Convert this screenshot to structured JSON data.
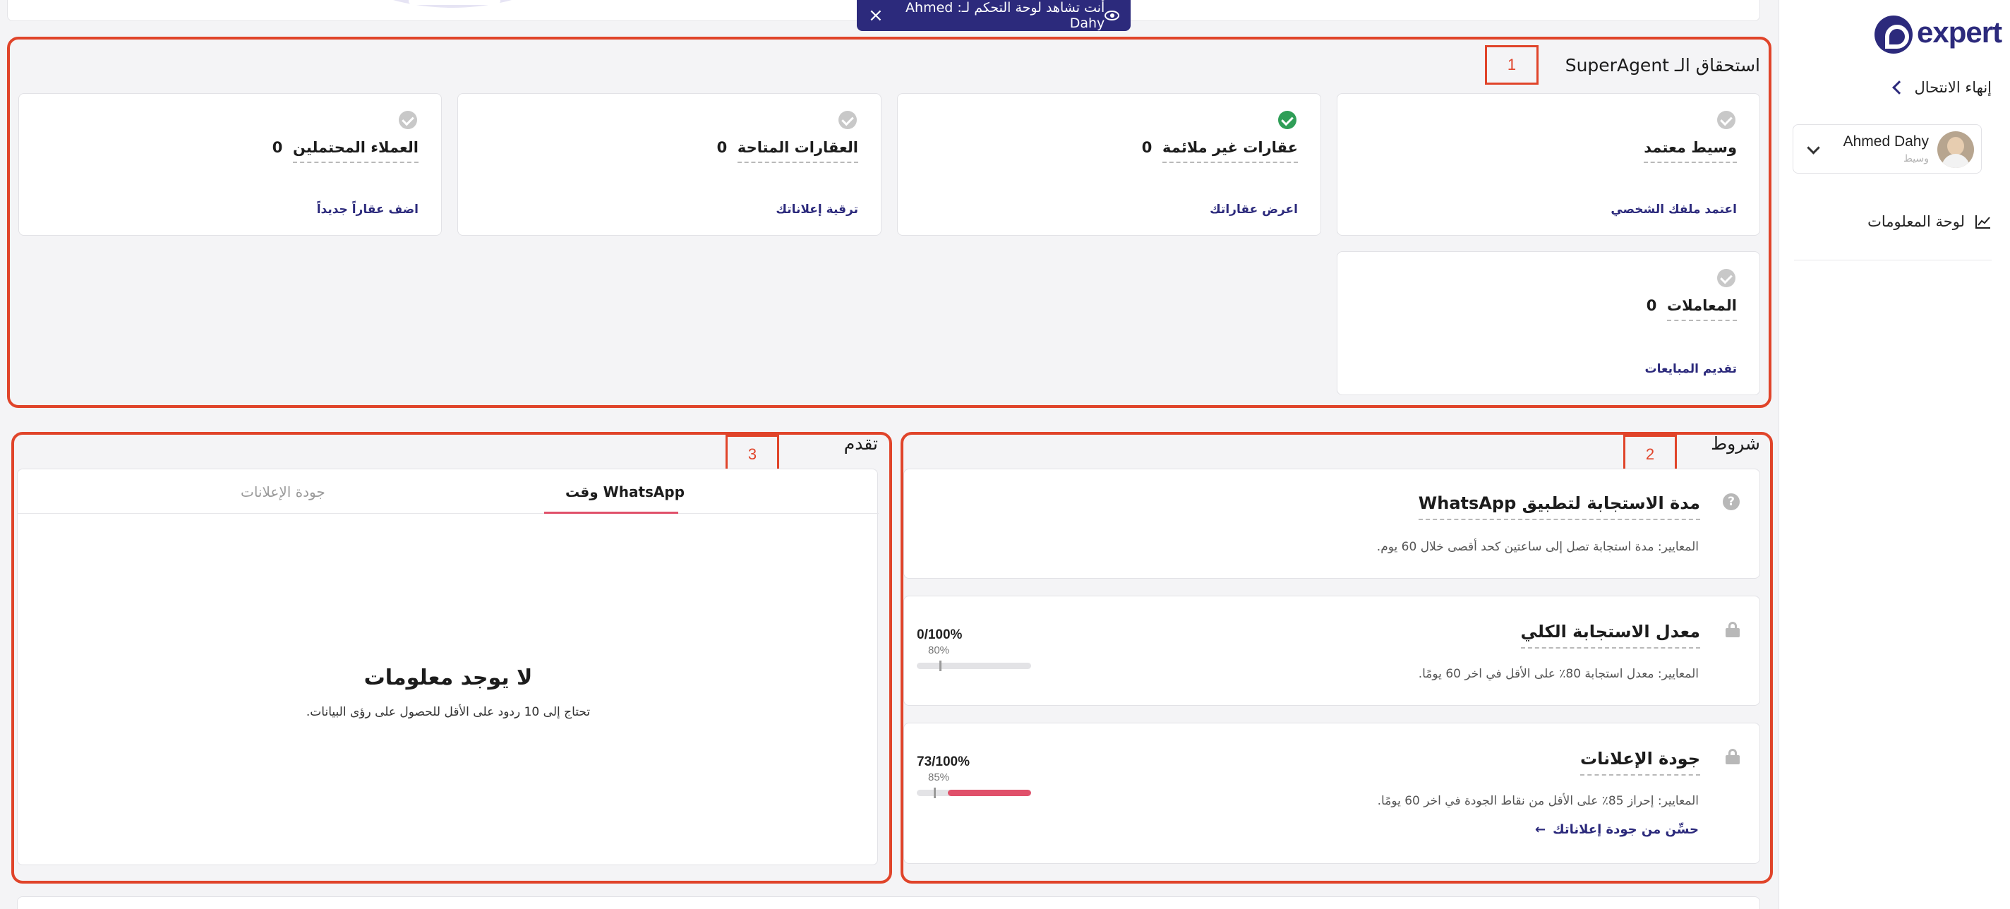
{
  "view_banner": {
    "text": "أنت تشاهد لوحة التحكم لـ: Ahmed Dahy",
    "eye_icon": "eye-icon",
    "close_icon": "close-icon"
  },
  "sidebar": {
    "logo": "expert",
    "end_session": "إنهاء الانتحال",
    "user": {
      "name": "Ahmed Dahy",
      "role": "وسيط"
    },
    "nav": [
      {
        "label": "لوحة المعلومات",
        "icon": "chart-line-icon"
      }
    ]
  },
  "eligibility": {
    "title": "استحقاق الـ SuperAgent",
    "tag": "1",
    "cards": [
      {
        "label": "وسيط معتمد",
        "value": "",
        "status": "pending",
        "link": "اعتمد ملفك الشخصي"
      },
      {
        "label": "عقارات غير ملائمة",
        "value": "0",
        "status": "done",
        "link": "اعرض عقاراتك"
      },
      {
        "label": "العقارات المتاحة",
        "value": "0",
        "status": "pending",
        "link": "ترقية إعلاناتك"
      },
      {
        "label": "العملاء المحتملين",
        "value": "0",
        "status": "pending",
        "link": "اضف عقاراً جديداً"
      },
      {
        "label": "المعاملات",
        "value": "0",
        "status": "pending",
        "link": "تقديم المبايعات"
      }
    ]
  },
  "conditions": {
    "title": "شروط",
    "tag": "2",
    "items": [
      {
        "title": "مدة الاستجابة لتطبيق WhatsApp",
        "desc": "المعايير: مدة استجابة تصل إلى ساعتين كحد أقصى خلال 60 يوم.",
        "icon": "help-icon"
      },
      {
        "title": "معدل الاستجابة الكلي",
        "desc": "المعايير: معدل استجابة 80٪ على الأقل في اخر 60 يومًا.",
        "icon": "lock-icon",
        "ratio": "0/100%",
        "threshold": "80%",
        "progress": 0,
        "threshold_value": 80
      },
      {
        "title": "جودة الإعلانات",
        "desc": "المعايير: إحراز 85٪ على الأقل من نقاط الجودة في اخر 60 يومًا.",
        "icon": "lock-icon",
        "ratio": "73/100%",
        "threshold": "85%",
        "progress": 73,
        "threshold_value": 85,
        "link": "حسِّن من جودة إعلاناتك"
      }
    ]
  },
  "progress": {
    "title": "تقدم",
    "tag": "3",
    "tabs": [
      {
        "label": "وقت WhatsApp",
        "active": true
      },
      {
        "label": "جودة الإعلانات",
        "active": false
      }
    ],
    "empty_title": "لا يوجد معلومات",
    "empty_subtitle": "تحتاج إلى 10 ردود على الأقل للحصول على رؤى البيانات."
  },
  "colors": {
    "brand": "#2c2a7c",
    "accent": "#e0506a",
    "annotation": "#e0442a",
    "success": "#2f9e57"
  }
}
